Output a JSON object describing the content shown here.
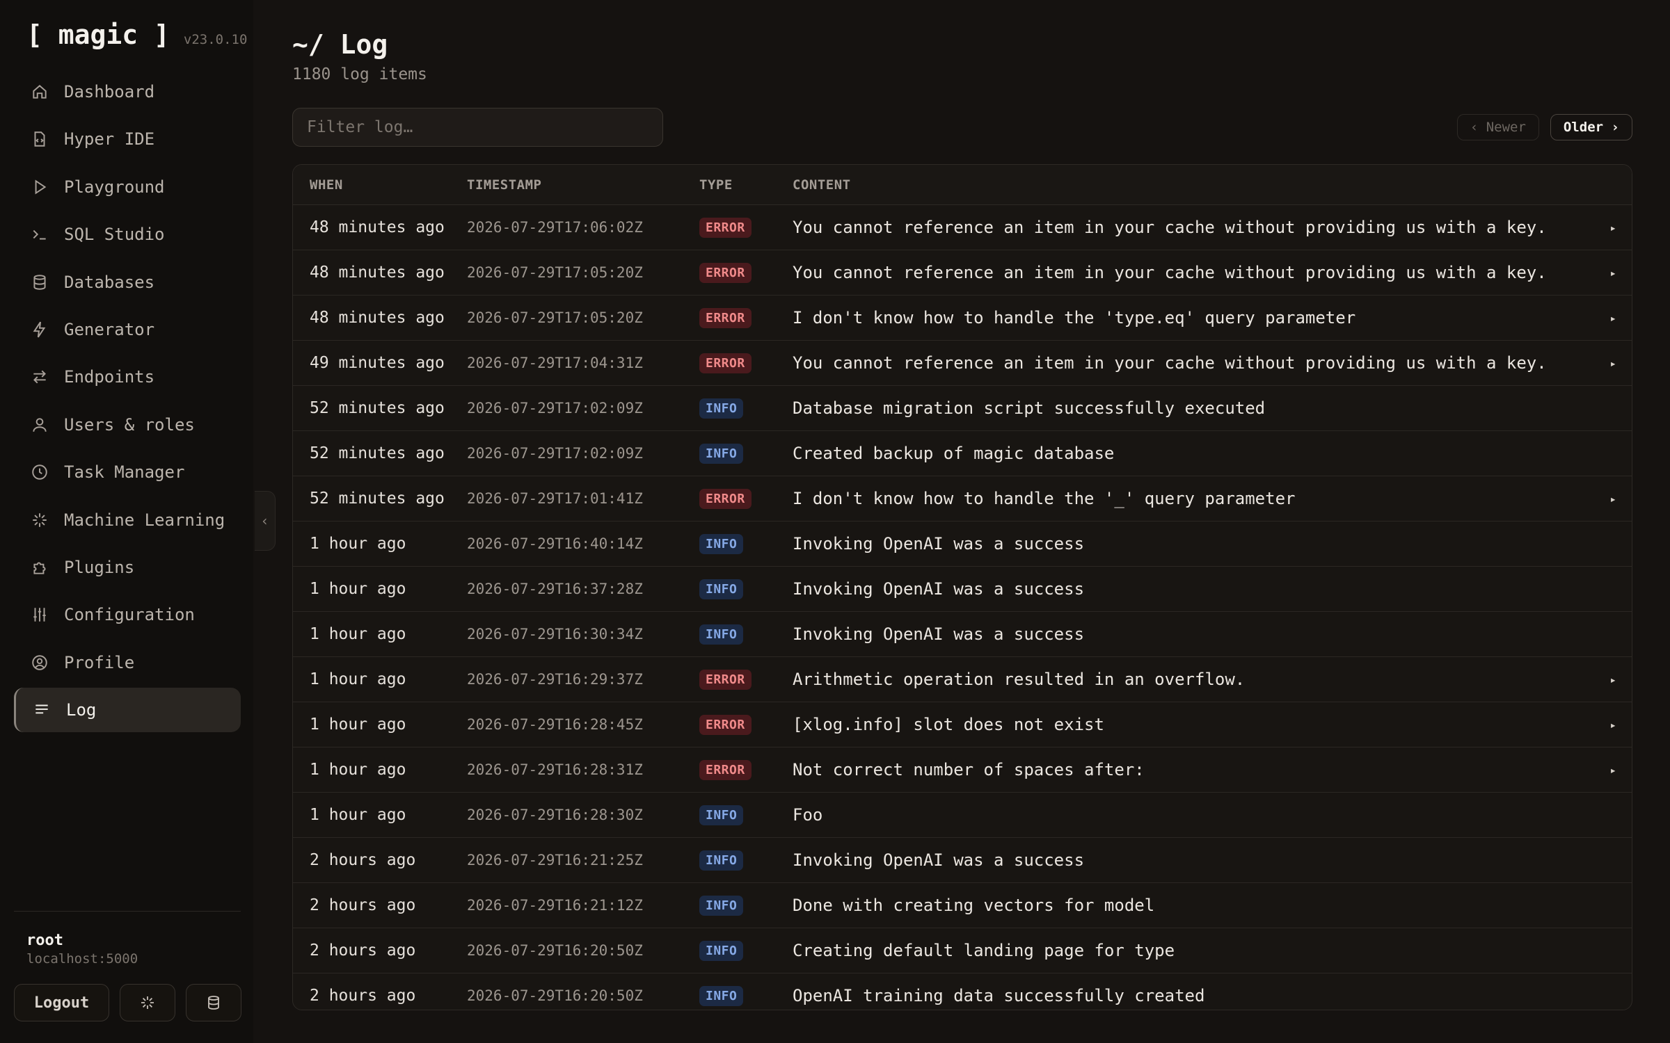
{
  "brand": {
    "name": "[ magic ]",
    "version": "v23.0.10"
  },
  "nav": [
    {
      "label": "Dashboard",
      "icon": "home-icon"
    },
    {
      "label": "Hyper IDE",
      "icon": "file-code-icon"
    },
    {
      "label": "Playground",
      "icon": "play-icon"
    },
    {
      "label": "SQL Studio",
      "icon": "terminal-icon"
    },
    {
      "label": "Databases",
      "icon": "database-icon"
    },
    {
      "label": "Generator",
      "icon": "bolt-icon"
    },
    {
      "label": "Endpoints",
      "icon": "arrows-icon"
    },
    {
      "label": "Users & roles",
      "icon": "user-icon"
    },
    {
      "label": "Task Manager",
      "icon": "clock-icon"
    },
    {
      "label": "Machine Learning",
      "icon": "sparkle-icon"
    },
    {
      "label": "Plugins",
      "icon": "puzzle-icon"
    },
    {
      "label": "Configuration",
      "icon": "sliders-icon"
    },
    {
      "label": "Profile",
      "icon": "user-circle-icon"
    },
    {
      "label": "Log",
      "icon": "list-icon",
      "active": true
    }
  ],
  "user": {
    "name": "root",
    "host": "localhost:5000",
    "logout_label": "Logout"
  },
  "page": {
    "title": "~/ Log",
    "subtitle": "1180 log items"
  },
  "filter": {
    "placeholder": "Filter log…",
    "value": ""
  },
  "pager": {
    "newer_label": "‹ Newer",
    "older_label": "Older ›"
  },
  "table": {
    "columns": [
      "WHEN",
      "TIMESTAMP",
      "TYPE",
      "CONTENT"
    ],
    "rows": [
      {
        "when": "48 minutes ago",
        "timestamp": "2026-07-29T17:06:02Z",
        "type": "ERROR",
        "content": "You cannot reference an item in your cache without providing us with a key.",
        "expandable": true
      },
      {
        "when": "48 minutes ago",
        "timestamp": "2026-07-29T17:05:20Z",
        "type": "ERROR",
        "content": "You cannot reference an item in your cache without providing us with a key.",
        "expandable": true
      },
      {
        "when": "48 minutes ago",
        "timestamp": "2026-07-29T17:05:20Z",
        "type": "ERROR",
        "content": "I don't know how to handle the 'type.eq' query parameter",
        "expandable": true
      },
      {
        "when": "49 minutes ago",
        "timestamp": "2026-07-29T17:04:31Z",
        "type": "ERROR",
        "content": "You cannot reference an item in your cache without providing us with a key.",
        "expandable": true
      },
      {
        "when": "52 minutes ago",
        "timestamp": "2026-07-29T17:02:09Z",
        "type": "INFO",
        "content": "Database migration script successfully executed",
        "expandable": false
      },
      {
        "when": "52 minutes ago",
        "timestamp": "2026-07-29T17:02:09Z",
        "type": "INFO",
        "content": "Created backup of magic database",
        "expandable": false
      },
      {
        "when": "52 minutes ago",
        "timestamp": "2026-07-29T17:01:41Z",
        "type": "ERROR",
        "content": "I don't know how to handle the '_' query parameter",
        "expandable": true
      },
      {
        "when": "1 hour ago",
        "timestamp": "2026-07-29T16:40:14Z",
        "type": "INFO",
        "content": "Invoking OpenAI was a success",
        "expandable": false
      },
      {
        "when": "1 hour ago",
        "timestamp": "2026-07-29T16:37:28Z",
        "type": "INFO",
        "content": "Invoking OpenAI was a success",
        "expandable": false
      },
      {
        "when": "1 hour ago",
        "timestamp": "2026-07-29T16:30:34Z",
        "type": "INFO",
        "content": "Invoking OpenAI was a success",
        "expandable": false
      },
      {
        "when": "1 hour ago",
        "timestamp": "2026-07-29T16:29:37Z",
        "type": "ERROR",
        "content": "Arithmetic operation resulted in an overflow.",
        "expandable": true
      },
      {
        "when": "1 hour ago",
        "timestamp": "2026-07-29T16:28:45Z",
        "type": "ERROR",
        "content": "[xlog.info] slot does not exist",
        "expandable": true
      },
      {
        "when": "1 hour ago",
        "timestamp": "2026-07-29T16:28:31Z",
        "type": "ERROR",
        "content": "Not correct number of spaces after:",
        "expandable": true
      },
      {
        "when": "1 hour ago",
        "timestamp": "2026-07-29T16:28:30Z",
        "type": "INFO",
        "content": "Foo",
        "expandable": false
      },
      {
        "when": "2 hours ago",
        "timestamp": "2026-07-29T16:21:25Z",
        "type": "INFO",
        "content": "Invoking OpenAI was a success",
        "expandable": false
      },
      {
        "when": "2 hours ago",
        "timestamp": "2026-07-29T16:21:12Z",
        "type": "INFO",
        "content": "Done with creating vectors for model",
        "expandable": false
      },
      {
        "when": "2 hours ago",
        "timestamp": "2026-07-29T16:20:50Z",
        "type": "INFO",
        "content": "Creating default landing page for type",
        "expandable": false
      },
      {
        "when": "2 hours ago",
        "timestamp": "2026-07-29T16:20:50Z",
        "type": "INFO",
        "content": "OpenAI training data successfully created",
        "expandable": false
      }
    ]
  },
  "colors": {
    "error_badge": "#4a1a1d",
    "info_badge": "#1c2a44",
    "background": "#151210"
  }
}
